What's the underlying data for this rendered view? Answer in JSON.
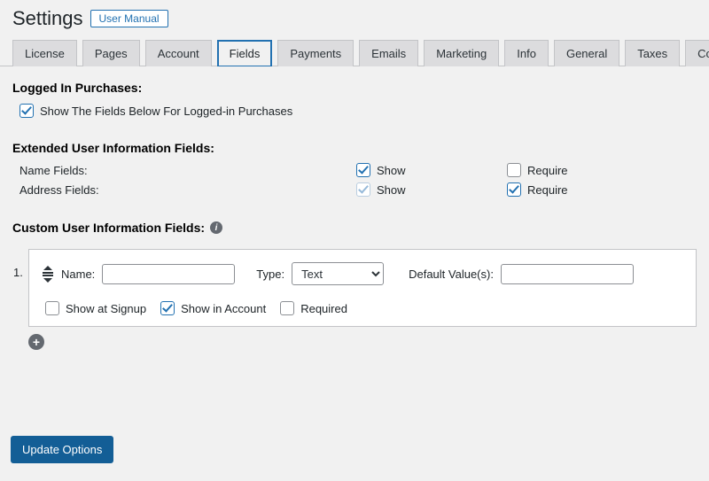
{
  "header": {
    "title": "Settings",
    "user_manual_label": "User Manual"
  },
  "tabs": [
    {
      "label": "License"
    },
    {
      "label": "Pages"
    },
    {
      "label": "Account"
    },
    {
      "label": "Fields",
      "active": true
    },
    {
      "label": "Payments"
    },
    {
      "label": "Emails"
    },
    {
      "label": "Marketing"
    },
    {
      "label": "Info"
    },
    {
      "label": "General"
    },
    {
      "label": "Taxes"
    },
    {
      "label": "Courses"
    }
  ],
  "sections": {
    "logged_in": {
      "title": "Logged In Purchases:",
      "show_fields_label": "Show The Fields Below For Logged-in Purchases",
      "show_fields_checked": true
    },
    "extended": {
      "title": "Extended User Information Fields:",
      "show_label": "Show",
      "require_label": "Require",
      "rows": [
        {
          "label": "Name Fields:",
          "show": true,
          "show_faded": false,
          "require": false
        },
        {
          "label": "Address Fields:",
          "show": true,
          "show_faded": true,
          "require": true
        }
      ]
    },
    "custom": {
      "title": "Custom User Information Fields:",
      "row_number": "1.",
      "name_label": "Name:",
      "name_value": "",
      "type_label": "Type:",
      "type_selected": "Text",
      "default_label": "Default Value(s):",
      "default_value": "",
      "show_signup_label": "Show at Signup",
      "show_signup_checked": false,
      "show_account_label": "Show in Account",
      "show_account_checked": true,
      "required_label": "Required",
      "required_checked": false
    }
  },
  "submit_label": "Update Options"
}
